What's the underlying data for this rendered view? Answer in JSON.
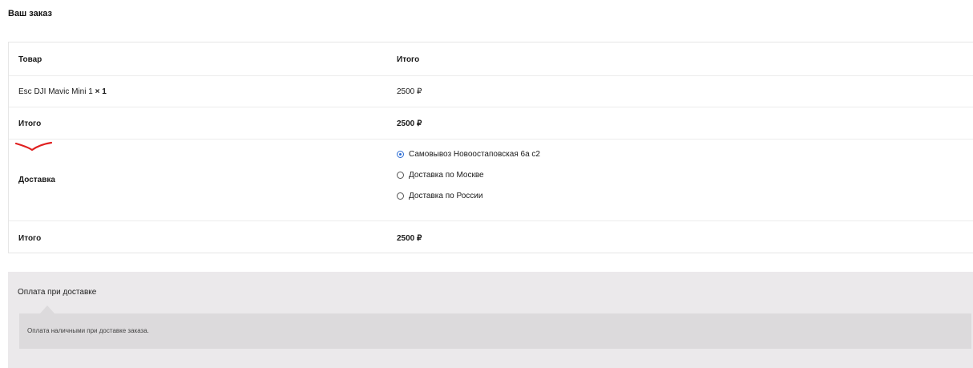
{
  "heading": "Ваш заказ",
  "table": {
    "header": {
      "product": "Товар",
      "total": "Итого"
    },
    "item": {
      "name": "Esc DJI Mavic Mini 1",
      "qty": "× 1",
      "price": "2500 ₽"
    },
    "subtotal": {
      "label": "Итого",
      "value": "2500 ₽"
    },
    "shipping": {
      "label": "Доставка",
      "options": [
        {
          "label": "Самовывоз Новоостаповская 6а с2",
          "checked": true
        },
        {
          "label": "Доставка по Москве",
          "checked": false
        },
        {
          "label": "Доставка по России",
          "checked": false
        }
      ]
    },
    "total": {
      "label": "Итого",
      "value": "2500 ₽"
    }
  },
  "payment": {
    "method": "Оплата при доставке",
    "description": "Оплата наличными при доставке заказа."
  },
  "colors": {
    "annotation": "#e02020",
    "radio_checked": "#2b6cd4",
    "payment_bg": "#ebe9eb",
    "payment_box": "#dcdadc"
  }
}
